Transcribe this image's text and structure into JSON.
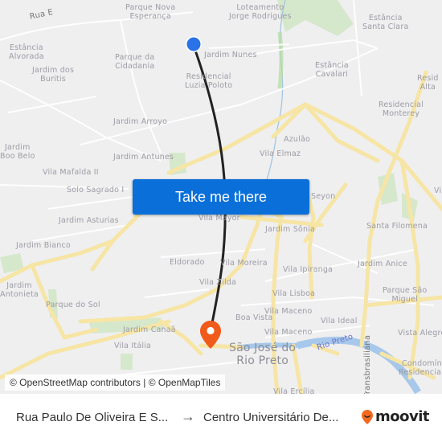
{
  "map": {
    "labels": [
      {
        "text": "Rua E",
        "kind": "road"
      },
      {
        "text": "Parque Nova\nEsperança"
      },
      {
        "text": "Loteamento\nJorge Rodrigues"
      },
      {
        "text": "Estância\nSanta Clara"
      },
      {
        "text": "Estância\nAlvorada"
      },
      {
        "text": "Parque da\nCidadania"
      },
      {
        "text": "Jardim Nunes"
      },
      {
        "text": "Jardim dos\nBuritis"
      },
      {
        "text": "Residencial\nLuzia Poloto"
      },
      {
        "text": "Estância\nCavalari"
      },
      {
        "text": "Resid\nAlta"
      },
      {
        "text": "Residencial\nMonterey"
      },
      {
        "text": "Jardim Arroyo"
      },
      {
        "text": "Azulão"
      },
      {
        "text": "Jardim\nBoo Belo"
      },
      {
        "text": "Jardim Antunes"
      },
      {
        "text": "Vila Elmaz"
      },
      {
        "text": "Vila Mafalda II"
      },
      {
        "text": "Solo Sagrado I"
      },
      {
        "text": "Seyon"
      },
      {
        "text": "Vi"
      },
      {
        "text": "Jardim Asturias"
      },
      {
        "text": "Vila Mayor"
      },
      {
        "text": "Jardim Sônia"
      },
      {
        "text": "Santa Filomena"
      },
      {
        "text": "Jardim Bianco"
      },
      {
        "text": "Eldorado"
      },
      {
        "text": "Vila Moreira"
      },
      {
        "text": "Vila Ipiranga"
      },
      {
        "text": "Jardim Anice"
      },
      {
        "text": "Jardim\nAntonieta"
      },
      {
        "text": "Vila Zilda"
      },
      {
        "text": "Vila Lisboa"
      },
      {
        "text": "Parque São\nMiguel"
      },
      {
        "text": "Parque do Sol"
      },
      {
        "text": "Boa Vista"
      },
      {
        "text": "Vila Maceno"
      },
      {
        "text": "Vila Ideal"
      },
      {
        "text": "Jardim Canaã"
      },
      {
        "text": "Vila Maceno"
      },
      {
        "text": "Vista Alegre"
      },
      {
        "text": "Vila Itália"
      },
      {
        "text": "São José do\nRio Preto",
        "kind": "big"
      },
      {
        "text": "Rio Preto",
        "kind": "river"
      },
      {
        "text": "Transbrasiliana",
        "kind": "road"
      },
      {
        "text": "Condomínio\nResidencial D"
      },
      {
        "text": "Vila Ercília"
      }
    ],
    "origin_marker": {
      "icon": "origin-dot-icon",
      "color": "#2a72e8"
    },
    "destination_marker": {
      "icon": "destination-pin-icon",
      "color": "#f05a1b"
    },
    "route_color": "#222222",
    "cta_label": "Take me there",
    "attribution": "© OpenStreetMap contributors | © OpenMapTiles"
  },
  "footer": {
    "from": "Rua Paulo De Oliveira E S...",
    "arrow": "→",
    "to": "Centro Universitário De...",
    "brand": "moovit",
    "brand_color": "#f26a20"
  }
}
